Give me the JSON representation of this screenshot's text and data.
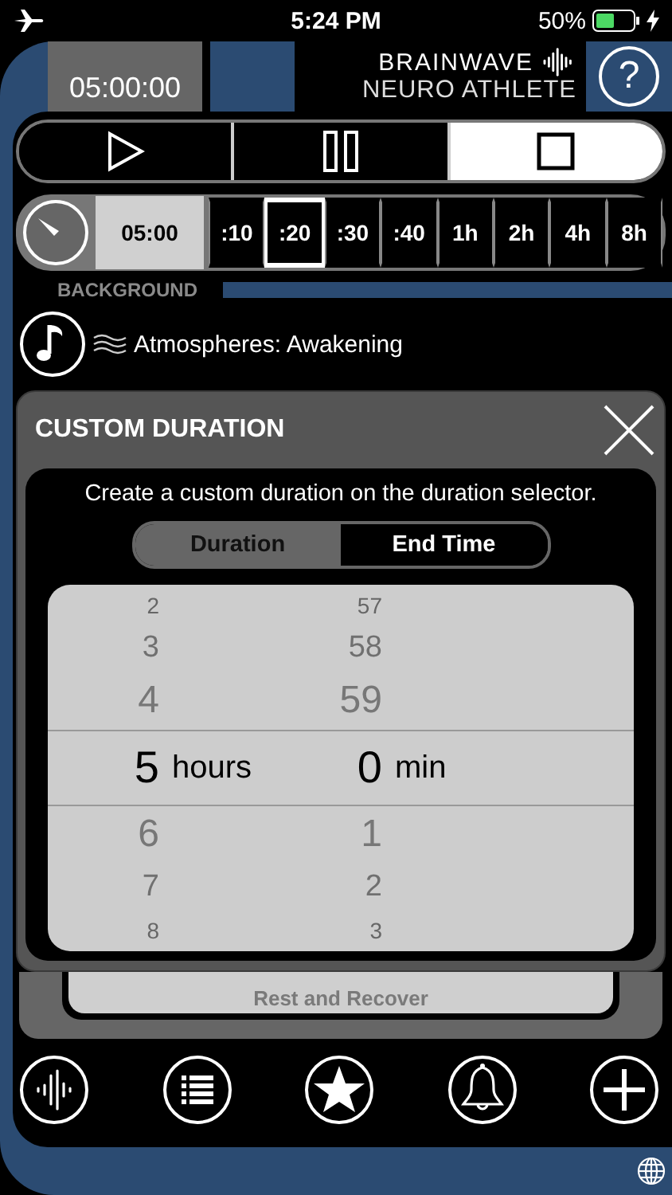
{
  "status_bar": {
    "time": "5:24 PM",
    "battery": "50%"
  },
  "header": {
    "timer": "05:00:00",
    "brand_top": "BRAINWAVE",
    "brand_bottom": "NEURO ATHLETE",
    "help": "?"
  },
  "transport": [
    {
      "kind": "play",
      "selected": false
    },
    {
      "kind": "pause",
      "selected": false
    },
    {
      "kind": "stop",
      "selected": true
    }
  ],
  "duration_bar": {
    "current": "05:00",
    "presets": [
      {
        "label": ":10",
        "selected": false
      },
      {
        "label": ":20",
        "selected": true
      },
      {
        "label": ":30",
        "selected": false
      },
      {
        "label": ":40",
        "selected": false
      },
      {
        "label": "1h",
        "selected": false
      },
      {
        "label": "2h",
        "selected": false
      },
      {
        "label": "4h",
        "selected": false
      },
      {
        "label": "8h",
        "selected": false
      }
    ]
  },
  "background": {
    "label": "BACKGROUND",
    "track": "Atmospheres: Awakening"
  },
  "modal": {
    "title": "CUSTOM DURATION",
    "description": "Create a custom duration on the duration selector.",
    "modes": [
      {
        "label": "Duration",
        "selected": true
      },
      {
        "label": "End Time",
        "selected": false
      }
    ],
    "picker": {
      "hour_unit": "hours",
      "minute_unit": "min",
      "rows": [
        {
          "hour": "2",
          "minute": "57",
          "selected": false
        },
        {
          "hour": "3",
          "minute": "58",
          "selected": false
        },
        {
          "hour": "4",
          "minute": "59",
          "selected": false
        },
        {
          "hour": "5",
          "minute": "0",
          "selected": true
        },
        {
          "hour": "6",
          "minute": "1",
          "selected": false
        },
        {
          "hour": "7",
          "minute": "2",
          "selected": false
        },
        {
          "hour": "8",
          "minute": "3",
          "selected": false
        }
      ]
    }
  },
  "behind_card": {
    "label": "Rest and Recover"
  },
  "nav": [
    {
      "kind": "waveform"
    },
    {
      "kind": "list"
    },
    {
      "kind": "star"
    },
    {
      "kind": "bell"
    },
    {
      "kind": "plus"
    }
  ]
}
